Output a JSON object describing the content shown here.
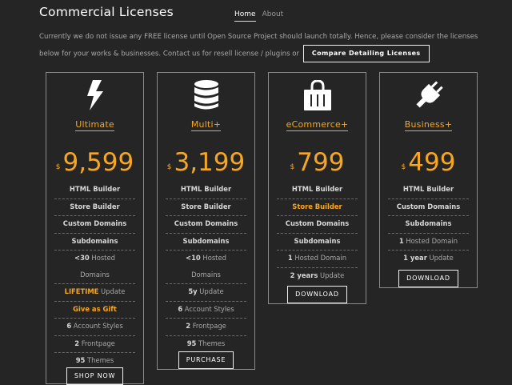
{
  "header": {
    "title": "Commercial Licenses"
  },
  "nav": {
    "home": "Home",
    "about": "About"
  },
  "intro": {
    "text": "Currently we do not issue any FREE license until Open Source Project should launch totally. Hence, please consider the licenses below for your works & businesses. Contact us for resell license / plugins or",
    "compare_button": "Compare Detailing Licenses"
  },
  "plans": [
    {
      "icon": "lightning-bolt-icon",
      "name": "Ultimate",
      "currency": "$",
      "price": "9,599",
      "features": [
        {
          "bold": "HTML Builder",
          "text": ""
        },
        {
          "bold": "Store Builder",
          "text": ""
        },
        {
          "bold": "Custom Domains",
          "text": ""
        },
        {
          "bold": "Subdomains",
          "text": ""
        },
        {
          "bold": "<30",
          "text": " Hosted"
        },
        {
          "bold": "",
          "text": "Domains"
        },
        {
          "bold": "LIFETIME",
          "text": " Update"
        },
        {
          "bold": "Give as Gift",
          "text": ""
        },
        {
          "bold": "6",
          "text": " Account Styles"
        },
        {
          "bold": "2",
          "text": " Frontpage"
        },
        {
          "bold": "95",
          "text": " Themes"
        }
      ],
      "button": "SHOP NOW"
    },
    {
      "icon": "database-icon",
      "name": "Multi+",
      "currency": "$",
      "price": "3,199",
      "features": [
        {
          "bold": "HTML Builder",
          "text": ""
        },
        {
          "bold": "Store Builder",
          "text": ""
        },
        {
          "bold": "Custom Domains",
          "text": ""
        },
        {
          "bold": "Subdomains",
          "text": ""
        },
        {
          "bold": "<10",
          "text": " Hosted"
        },
        {
          "bold": "",
          "text": "Domains"
        },
        {
          "bold": "5y",
          "text": " Update"
        },
        {
          "bold": "6",
          "text": " Account Styles"
        },
        {
          "bold": "2",
          "text": " Frontpage"
        },
        {
          "bold": "95",
          "text": " Themes"
        }
      ],
      "button": "PURCHASE"
    },
    {
      "icon": "shopping-bag-icon",
      "name": "eCommerce+",
      "currency": "$",
      "price": "799",
      "features": [
        {
          "bold": "HTML Builder",
          "text": ""
        },
        {
          "bold": "Store Builder",
          "text": ""
        },
        {
          "bold": "Custom Domains",
          "text": ""
        },
        {
          "bold": "Subdomains",
          "text": ""
        },
        {
          "bold": "1",
          "text": " Hosted Domain"
        },
        {
          "bold": "2 years",
          "text": " Update"
        }
      ],
      "button": "DOWNLOAD"
    },
    {
      "icon": "plug-icon",
      "name": "Business+",
      "currency": "$",
      "price": "499",
      "features": [
        {
          "bold": "HTML Builder",
          "text": ""
        },
        {
          "bold": "Custom Domains",
          "text": ""
        },
        {
          "bold": "Subdomains",
          "text": ""
        },
        {
          "bold": "1",
          "text": " Hosted Domain"
        },
        {
          "bold": "1 year",
          "text": " Update"
        }
      ],
      "button": "DOWNLOAD"
    }
  ],
  "colors": {
    "accent": "#f5a623",
    "background": "#252525",
    "text": "#a8a8a8"
  }
}
